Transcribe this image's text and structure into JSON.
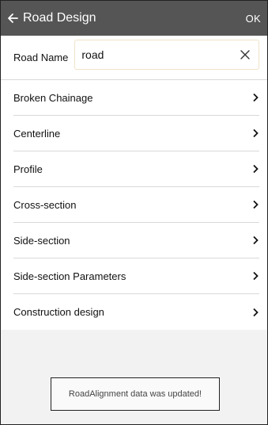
{
  "app_bar": {
    "title": "Road Design",
    "ok_label": "OK",
    "back_icon": "arrow-left-icon"
  },
  "road_name": {
    "label": "Road Name",
    "value": "road",
    "clear_icon": "close-icon"
  },
  "menu": {
    "items": [
      {
        "label": "Broken Chainage"
      },
      {
        "label": "Centerline"
      },
      {
        "label": "Profile"
      },
      {
        "label": "Cross-section"
      },
      {
        "label": "Side-section"
      },
      {
        "label": "Side-section Parameters"
      },
      {
        "label": "Construction design"
      }
    ],
    "chevron_icon": "chevron-right-icon"
  },
  "toast": {
    "message": "RoadAlignment data was updated!"
  },
  "colors": {
    "app_bar": "#555555",
    "background": "#f2f2f2",
    "divider": "#d9d9d9",
    "input_border": "#f0e3c8"
  }
}
